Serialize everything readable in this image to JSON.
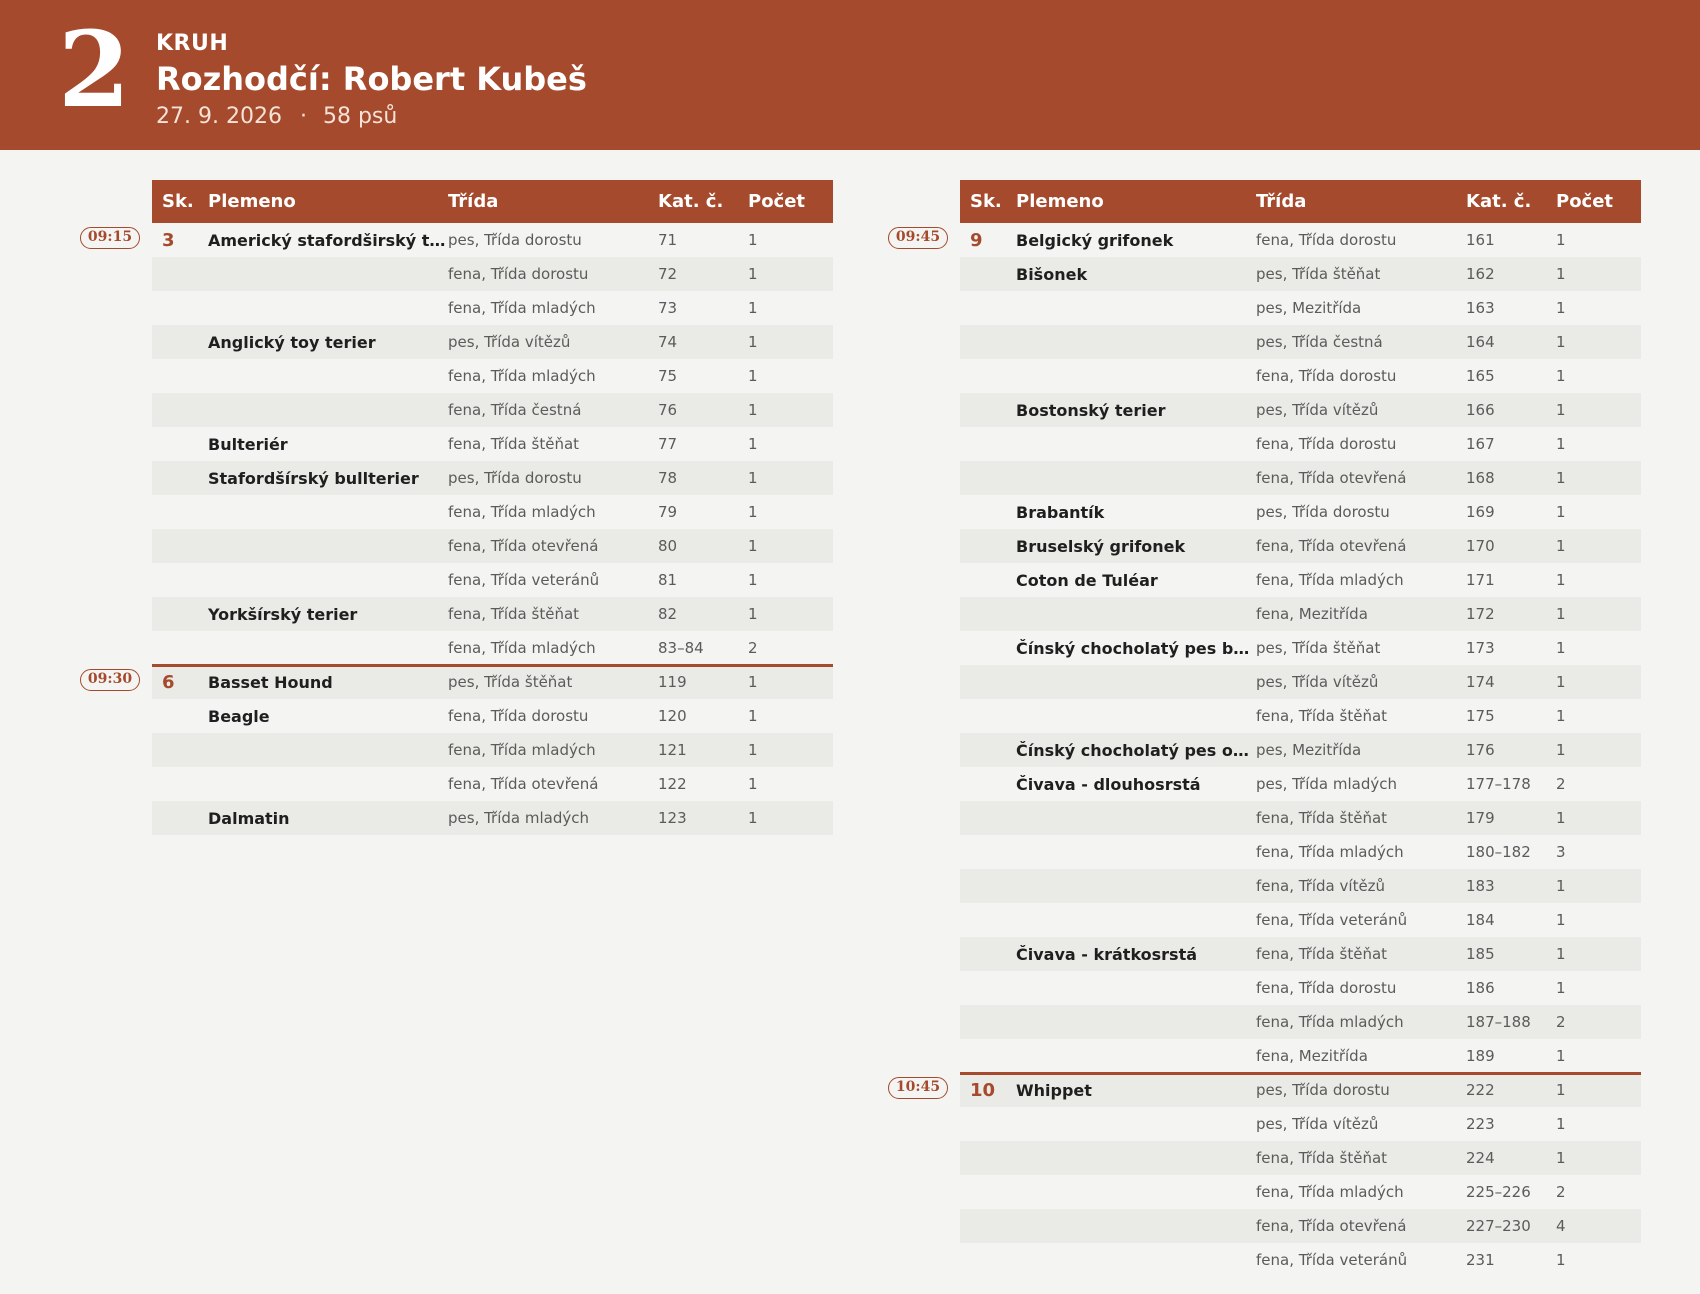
{
  "header": {
    "ring_number": "2",
    "label": "KRUH",
    "title": "Rozhodčí: Robert Kubeš",
    "date": "27. 9. 2026",
    "separator": "·",
    "dog_count": "58 psů"
  },
  "columns": {
    "group": "Sk.",
    "breed": "Plemeno",
    "class": "Třída",
    "catalog": "Kat. č.",
    "count": "Počet"
  },
  "left_rows": [
    {
      "time": "09:15",
      "group": "3",
      "breed": "Americký stafordširský teriér",
      "class": "pes, Třída dorostu",
      "catalog": "71",
      "count": "1"
    },
    {
      "breed": "",
      "class": "fena, Třída dorostu",
      "catalog": "72",
      "count": "1"
    },
    {
      "breed": "",
      "class": "fena, Třída mladých",
      "catalog": "73",
      "count": "1"
    },
    {
      "breed": "Anglický toy terier",
      "class": "pes, Třída vítězů",
      "catalog": "74",
      "count": "1"
    },
    {
      "breed": "",
      "class": "fena, Třída mladých",
      "catalog": "75",
      "count": "1"
    },
    {
      "breed": "",
      "class": "fena, Třída čestná",
      "catalog": "76",
      "count": "1"
    },
    {
      "breed": "Bulteriér",
      "class": "fena, Třída štěňat",
      "catalog": "77",
      "count": "1"
    },
    {
      "breed": "Stafordšírský bullterier",
      "class": "pes, Třída dorostu",
      "catalog": "78",
      "count": "1"
    },
    {
      "breed": "",
      "class": "fena, Třída mladých",
      "catalog": "79",
      "count": "1"
    },
    {
      "breed": "",
      "class": "fena, Třída otevřená",
      "catalog": "80",
      "count": "1"
    },
    {
      "breed": "",
      "class": "fena, Třída veteránů",
      "catalog": "81",
      "count": "1"
    },
    {
      "breed": "Yorkšírský terier",
      "class": "fena, Třída štěňat",
      "catalog": "82",
      "count": "1"
    },
    {
      "breed": "",
      "class": "fena, Třída mladých",
      "catalog": "83–84",
      "count": "2"
    },
    {
      "time": "09:30",
      "group": "6",
      "breed": "Basset Hound",
      "class": "pes, Třída štěňat",
      "catalog": "119",
      "count": "1"
    },
    {
      "breed": "Beagle",
      "class": "fena, Třída dorostu",
      "catalog": "120",
      "count": "1"
    },
    {
      "breed": "",
      "class": "fena, Třída mladých",
      "catalog": "121",
      "count": "1"
    },
    {
      "breed": "",
      "class": "fena, Třída otevřená",
      "catalog": "122",
      "count": "1"
    },
    {
      "breed": "Dalmatin",
      "class": "pes, Třída mladých",
      "catalog": "123",
      "count": "1"
    }
  ],
  "right_rows": [
    {
      "time": "09:45",
      "group": "9",
      "breed": "Belgický grifonek",
      "class": "fena, Třída dorostu",
      "catalog": "161",
      "count": "1"
    },
    {
      "breed": "Bišonek",
      "class": "pes, Třída štěňat",
      "catalog": "162",
      "count": "1"
    },
    {
      "breed": "",
      "class": "pes, Mezitřída",
      "catalog": "163",
      "count": "1"
    },
    {
      "breed": "",
      "class": "pes, Třída čestná",
      "catalog": "164",
      "count": "1"
    },
    {
      "breed": "",
      "class": "fena, Třída dorostu",
      "catalog": "165",
      "count": "1"
    },
    {
      "breed": "Bostonský terier",
      "class": "pes, Třída vítězů",
      "catalog": "166",
      "count": "1"
    },
    {
      "breed": "",
      "class": "fena, Třída dorostu",
      "catalog": "167",
      "count": "1"
    },
    {
      "breed": "",
      "class": "fena, Třída otevřená",
      "catalog": "168",
      "count": "1"
    },
    {
      "breed": "Brabantík",
      "class": "pes, Třída dorostu",
      "catalog": "169",
      "count": "1"
    },
    {
      "breed": "Bruselský grifonek",
      "class": "fena, Třída otevřená",
      "catalog": "170",
      "count": "1"
    },
    {
      "breed": "Coton de Tuléar",
      "class": "fena, Třída mladých",
      "catalog": "171",
      "count": "1"
    },
    {
      "breed": "",
      "class": "fena, Mezitřída",
      "catalog": "172",
      "count": "1"
    },
    {
      "breed": "Čínský chocholatý pes bezsrstý",
      "class": "pes, Třída štěňat",
      "catalog": "173",
      "count": "1"
    },
    {
      "breed": "",
      "class": "pes, Třída vítězů",
      "catalog": "174",
      "count": "1"
    },
    {
      "breed": "",
      "class": "fena, Třída štěňat",
      "catalog": "175",
      "count": "1"
    },
    {
      "breed": "Čínský chocholatý pes osrstěný",
      "class": "pes, Mezitřída",
      "catalog": "176",
      "count": "1"
    },
    {
      "breed": "Čivava - dlouhosrstá",
      "class": "pes, Třída mladých",
      "catalog": "177–178",
      "count": "2"
    },
    {
      "breed": "",
      "class": "fena, Třída štěňat",
      "catalog": "179",
      "count": "1"
    },
    {
      "breed": "",
      "class": "fena, Třída mladých",
      "catalog": "180–182",
      "count": "3"
    },
    {
      "breed": "",
      "class": "fena, Třída vítězů",
      "catalog": "183",
      "count": "1"
    },
    {
      "breed": "",
      "class": "fena, Třída veteránů",
      "catalog": "184",
      "count": "1"
    },
    {
      "breed": "Čivava - krátkosrstá",
      "class": "fena, Třída štěňat",
      "catalog": "185",
      "count": "1"
    },
    {
      "breed": "",
      "class": "fena, Třída dorostu",
      "catalog": "186",
      "count": "1"
    },
    {
      "breed": "",
      "class": "fena, Třída mladých",
      "catalog": "187–188",
      "count": "2"
    },
    {
      "breed": "",
      "class": "fena, Mezitřída",
      "catalog": "189",
      "count": "1"
    },
    {
      "time": "10:45",
      "group": "10",
      "breed": "Whippet",
      "class": "pes, Třída dorostu",
      "catalog": "222",
      "count": "1"
    },
    {
      "breed": "",
      "class": "pes, Třída vítězů",
      "catalog": "223",
      "count": "1"
    },
    {
      "breed": "",
      "class": "fena, Třída štěňat",
      "catalog": "224",
      "count": "1"
    },
    {
      "breed": "",
      "class": "fena, Třída mladých",
      "catalog": "225–226",
      "count": "2"
    },
    {
      "breed": "",
      "class": "fena, Třída otevřená",
      "catalog": "227–230",
      "count": "4"
    },
    {
      "breed": "",
      "class": "fena, Třída veteránů",
      "catalog": "231",
      "count": "1"
    }
  ]
}
